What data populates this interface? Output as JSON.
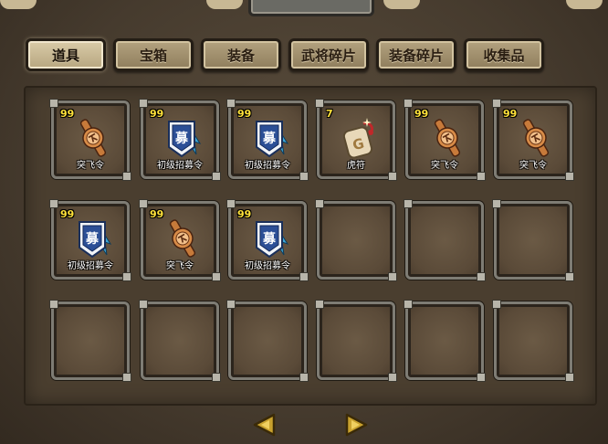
{
  "tabs": [
    {
      "label": "道具",
      "active": true
    },
    {
      "label": "宝箱",
      "active": false
    },
    {
      "label": "装备",
      "active": false
    },
    {
      "label": "武将碎片",
      "active": false
    },
    {
      "label": "装备碎片",
      "active": false
    },
    {
      "label": "收集品",
      "active": false
    }
  ],
  "slots": [
    {
      "count": "99",
      "label": "突飞令",
      "icon": "token-icon"
    },
    {
      "count": "99",
      "label": "初级招募令",
      "icon": "recruit-order-icon"
    },
    {
      "count": "99",
      "label": "初级招募令",
      "icon": "recruit-order-icon"
    },
    {
      "count": "7",
      "label": "虎符",
      "icon": "tiger-tally-icon"
    },
    {
      "count": "99",
      "label": "突飞令",
      "icon": "token-icon"
    },
    {
      "count": "99",
      "label": "突飞令",
      "icon": "token-icon"
    },
    {
      "count": "99",
      "label": "初级招募令",
      "icon": "recruit-order-icon"
    },
    {
      "count": "99",
      "label": "突飞令",
      "icon": "token-icon"
    },
    {
      "count": "99",
      "label": "初级招募令",
      "icon": "recruit-order-icon"
    },
    {
      "count": "",
      "label": "",
      "icon": ""
    },
    {
      "count": "",
      "label": "",
      "icon": ""
    },
    {
      "count": "",
      "label": "",
      "icon": ""
    },
    {
      "count": "",
      "label": "",
      "icon": ""
    },
    {
      "count": "",
      "label": "",
      "icon": ""
    },
    {
      "count": "",
      "label": "",
      "icon": ""
    },
    {
      "count": "",
      "label": "",
      "icon": ""
    },
    {
      "count": "",
      "label": "",
      "icon": ""
    },
    {
      "count": "",
      "label": "",
      "icon": ""
    }
  ],
  "pager": {
    "prev_icon": "left-arrow-icon",
    "next_icon": "right-arrow-icon"
  },
  "colors": {
    "count": "#ffe23a",
    "tab_bg": "#a8976f",
    "panel_bg": "#4a3e2f"
  }
}
